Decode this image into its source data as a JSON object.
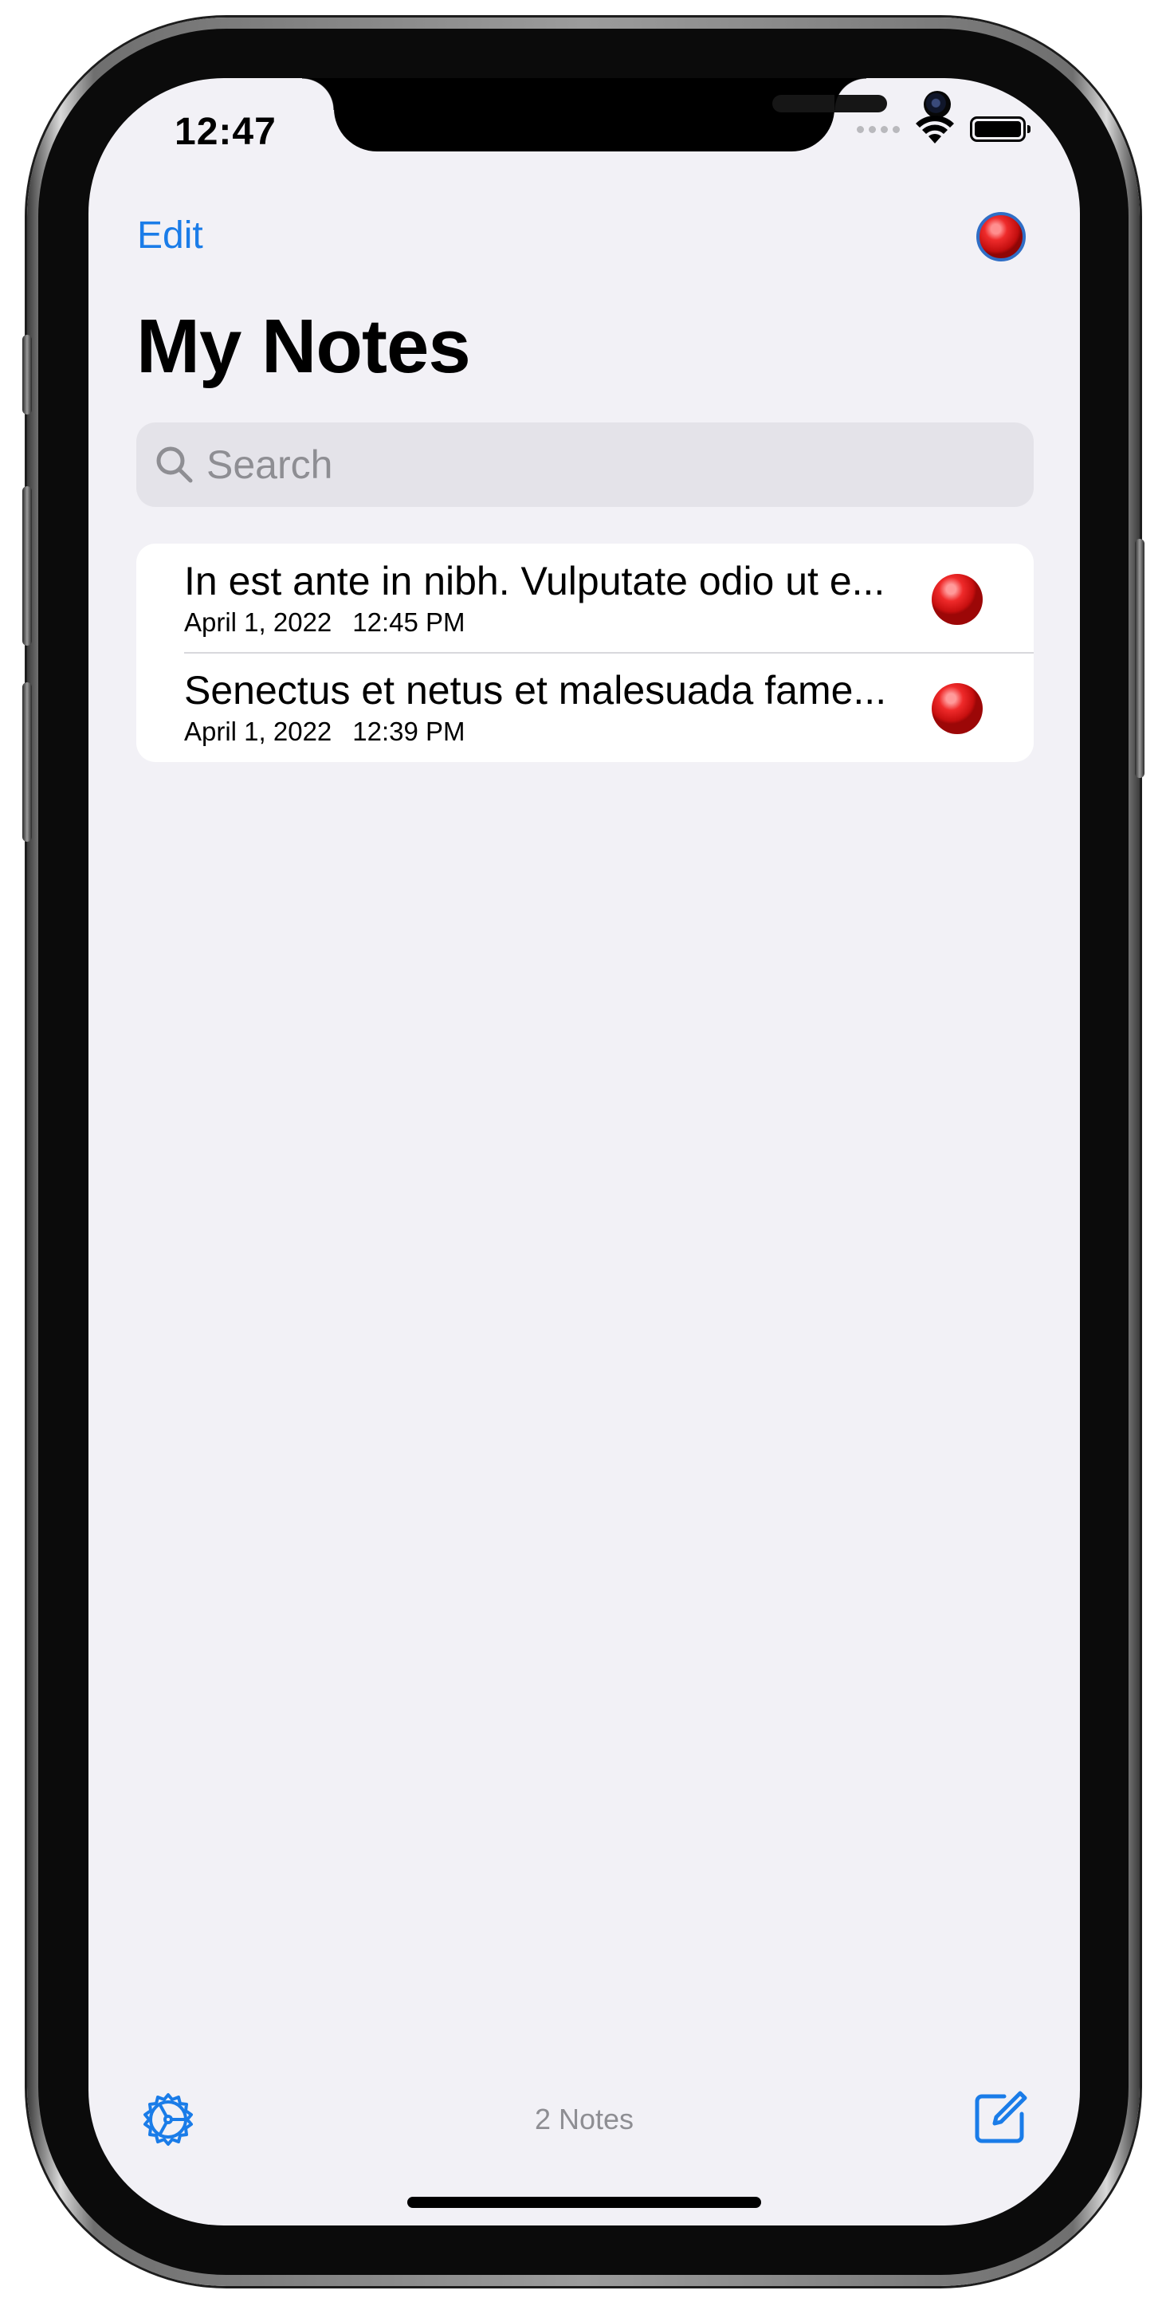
{
  "status_bar": {
    "time": "12:47"
  },
  "nav": {
    "edit_label": "Edit",
    "record_icon": "red-circle-icon",
    "title": "My Notes"
  },
  "search": {
    "placeholder": "Search",
    "icon": "search-icon"
  },
  "notes": [
    {
      "title": "In est ante in nibh. Vulputate odio ut e...",
      "date": "April 1, 2022",
      "time": "12:45 PM",
      "indicator": "red-circle-icon"
    },
    {
      "title": "Senectus et netus et malesuada fame...",
      "date": "April 1, 2022",
      "time": "12:39 PM",
      "indicator": "red-circle-icon"
    }
  ],
  "toolbar": {
    "settings_icon": "settings-gear-icon",
    "count_label": "2 Notes",
    "compose_icon": "compose-icon"
  },
  "colors": {
    "accent": "#1a7ce8",
    "background": "#f2f1f6",
    "indicator_red": "#d41515"
  }
}
